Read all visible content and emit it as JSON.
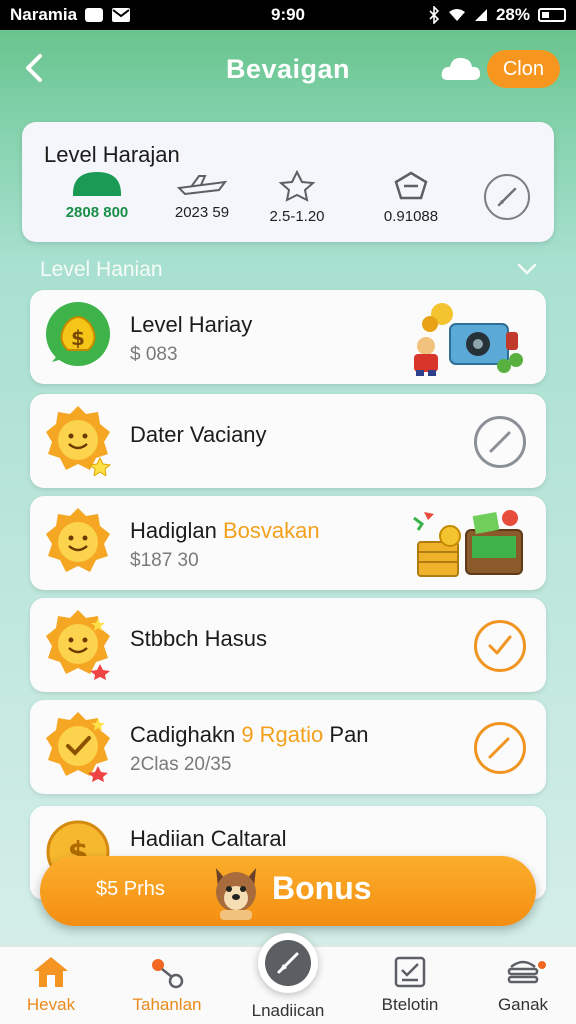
{
  "status_bar": {
    "carrier": "Naramia",
    "time": "9:90",
    "battery": "28%"
  },
  "header": {
    "title": "Bevaigan",
    "action_label": "Clon"
  },
  "level_card": {
    "title": "Level Harajan",
    "stats": [
      {
        "icon": "gauge-icon",
        "value": "2808 800"
      },
      {
        "icon": "airplane-icon",
        "value": "2023 59"
      },
      {
        "icon": "star-icon",
        "value": "2.5-1.20"
      },
      {
        "icon": "badge-icon",
        "value": "0.91088"
      }
    ],
    "edit_icon": "edit-pencil-icon"
  },
  "section": {
    "label": "Level Hanian"
  },
  "list_items": [
    {
      "title": "Level Hariay",
      "subtitle": "$ 083",
      "icon": "money-bag-icon"
    },
    {
      "title": "Dater Vaciany",
      "subtitle": "",
      "icon": "smiley-sun-icon"
    },
    {
      "title": "Hadiglan",
      "title_accent": "Bosvakan",
      "subtitle": "$187 30",
      "icon": "smiley-sun-icon"
    },
    {
      "title": "Stbbch Hasus",
      "subtitle": "",
      "icon": "smiley-sun-icon"
    },
    {
      "title": "Cadighakn",
      "title_accent": "9 Rgatio",
      "title_tail": "Pan",
      "subtitle": "2Clas 20/35",
      "icon": "check-badge-icon"
    },
    {
      "title": "Hadiian Caltaral",
      "subtitle": "",
      "icon": "dollar-coin-icon"
    }
  ],
  "bonus_bar": {
    "prize": "$5 Prhs",
    "label": "Bonus"
  },
  "bottom_nav": {
    "items": [
      {
        "label": "Hevak",
        "icon": "home-icon"
      },
      {
        "label": "Tahanlan",
        "icon": "share-icon"
      },
      {
        "label": "Lnadiican",
        "icon": "compass-icon"
      },
      {
        "label": "Btelotin",
        "icon": "checklist-icon"
      },
      {
        "label": "Ganak",
        "icon": "stack-icon"
      }
    ]
  },
  "colors": {
    "header_green": "#5fbf82",
    "accent_orange": "#f7961f",
    "stat_green": "#1b8e4a"
  }
}
